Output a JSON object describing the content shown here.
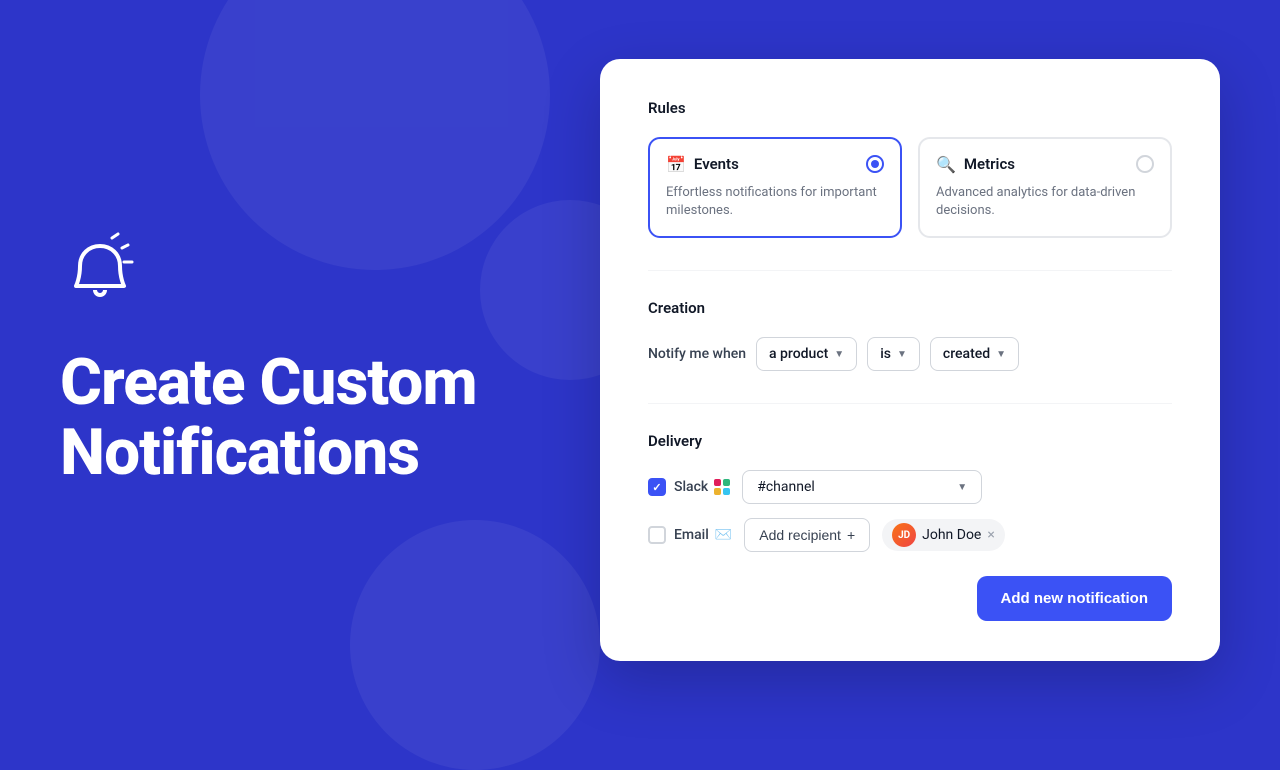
{
  "page": {
    "background_color": "#2d35c9"
  },
  "left": {
    "hero_title": "Create Custom Notifications"
  },
  "card": {
    "rules_section": {
      "label": "Rules",
      "events_card": {
        "title": "Events",
        "description": "Effortless notifications for important milestones.",
        "selected": true
      },
      "metrics_card": {
        "title": "Metrics",
        "description": "Advanced analytics for data-driven decisions.",
        "selected": false
      }
    },
    "creation_section": {
      "label": "Creation",
      "notify_label": "Notify me when",
      "product_dropdown": "a product",
      "is_dropdown": "is",
      "created_dropdown": "created"
    },
    "delivery_section": {
      "label": "Delivery",
      "slack": {
        "label": "Slack",
        "checked": true,
        "channel_placeholder": "#channel"
      },
      "email": {
        "label": "Email",
        "checked": false,
        "add_recipient_label": "Add recipient",
        "recipient_name": "John Doe",
        "recipient_initials": "JD"
      }
    },
    "footer": {
      "add_button_label": "Add new notification"
    }
  }
}
